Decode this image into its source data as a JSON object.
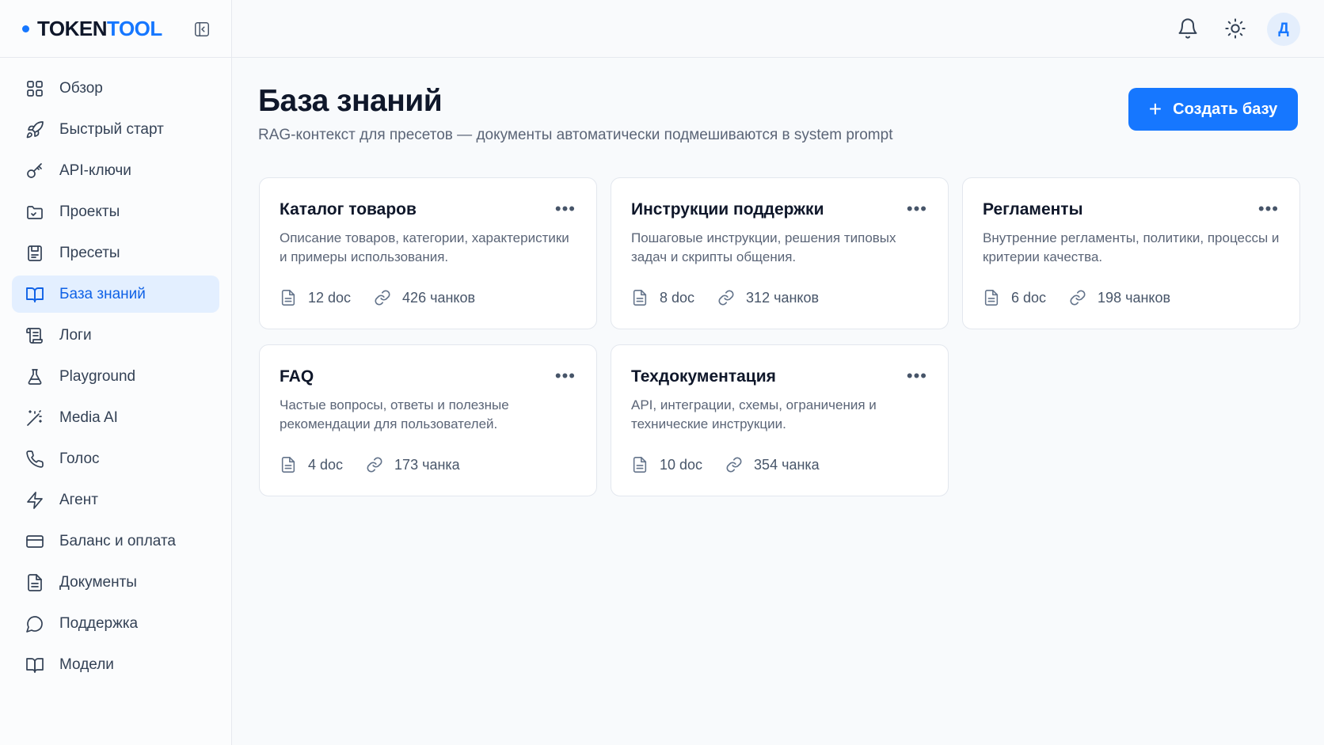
{
  "brand": {
    "part1": "TOKEN",
    "part2": "TOOL",
    "accent": "#1677ff"
  },
  "sidebar": {
    "items": [
      {
        "label": "Обзор",
        "icon": "grid-icon",
        "active": false
      },
      {
        "label": "Быстрый старт",
        "icon": "rocket-icon",
        "active": false
      },
      {
        "label": "API-ключи",
        "icon": "key-icon",
        "active": false
      },
      {
        "label": "Проекты",
        "icon": "folder-icon",
        "active": false
      },
      {
        "label": "Пресеты",
        "icon": "preset-icon",
        "active": false
      },
      {
        "label": "База знаний",
        "icon": "book-icon",
        "active": true
      },
      {
        "label": "Логи",
        "icon": "scroll-icon",
        "active": false
      },
      {
        "label": "Playground",
        "icon": "flask-icon",
        "active": false
      },
      {
        "label": "Media AI",
        "icon": "magic-wand-icon",
        "active": false
      },
      {
        "label": "Голос",
        "icon": "phone-icon",
        "active": false
      },
      {
        "label": "Агент",
        "icon": "lightning-icon",
        "active": false
      },
      {
        "label": "Баланс и оплата",
        "icon": "credit-card-icon",
        "active": false
      },
      {
        "label": "Документы",
        "icon": "document-icon",
        "active": false
      },
      {
        "label": "Поддержка",
        "icon": "chat-bubble-icon",
        "active": false
      },
      {
        "label": "Модели",
        "icon": "book-open-icon",
        "active": false
      }
    ]
  },
  "header": {
    "avatar_letter": "Д"
  },
  "main": {
    "title": "База знаний",
    "subtitle": "RAG-контекст для пресетов — документы автоматически подмешиваются в system prompt",
    "create_button": "Создать базу"
  },
  "cards": [
    {
      "title": "Каталог товаров",
      "desc": "Описание товаров, категории, характеристики и примеры использования.",
      "docs": "12 doc",
      "chunks": "426 чанков"
    },
    {
      "title": "Инструкции поддержки",
      "desc": "Пошаговые инструкции, решения типовых задач и скрипты общения.",
      "docs": "8 doc",
      "chunks": "312 чанков"
    },
    {
      "title": "Регламенты",
      "desc": "Внутренние регламенты, политики, процессы и критерии качества.",
      "docs": "6 doc",
      "chunks": "198 чанков"
    },
    {
      "title": "FAQ",
      "desc": "Частые вопросы, ответы и полезные рекомендации для пользователей.",
      "docs": "4 doc",
      "chunks": "173 чанка"
    },
    {
      "title": "Техдокументация",
      "desc": "API, интеграции, схемы, ограничения и технические инструкции.",
      "docs": "10 doc",
      "chunks": "354 чанка"
    }
  ]
}
